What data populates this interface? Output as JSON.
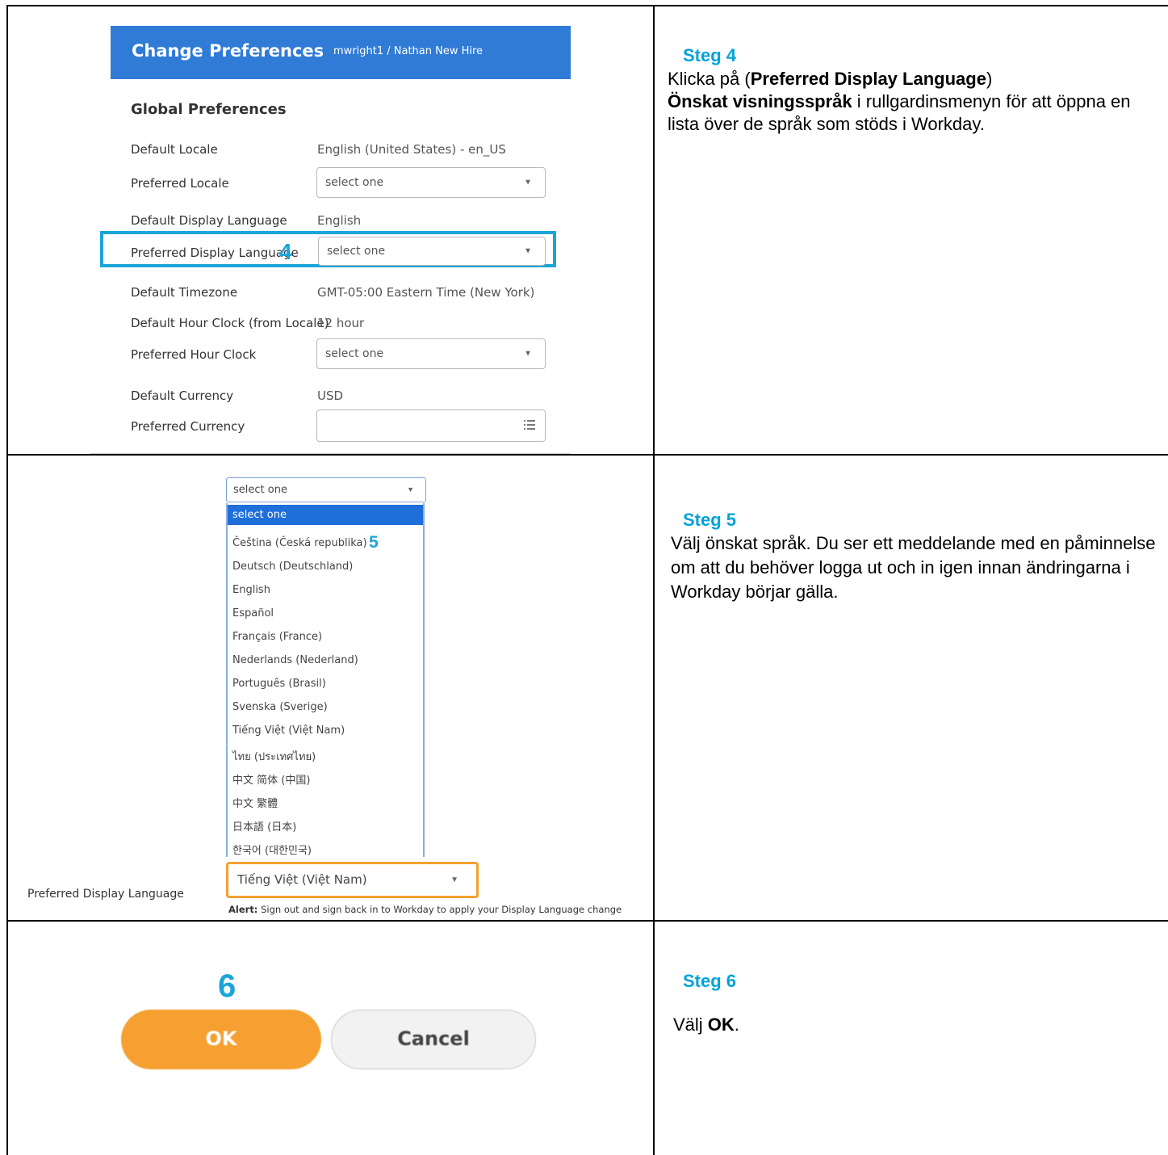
{
  "step4": {
    "header_title": "Change Preferences",
    "header_user": "mwright1 / Nathan New Hire",
    "section_title": "Global Preferences",
    "rows": [
      {
        "label": "Default Locale",
        "value": "English (United States) - en_US"
      },
      {
        "label": "Preferred Locale",
        "value": "select one"
      },
      {
        "label": "Default Display Language",
        "value": "English"
      },
      {
        "label": "Preferred Display Language",
        "value": "select one"
      },
      {
        "label": "Default Timezone",
        "value": "GMT-05:00 Eastern Time (New York)"
      },
      {
        "label": "Default Hour Clock (from Locale)",
        "value": "12 hour"
      },
      {
        "label": "Preferred Hour Clock",
        "value": "select one"
      },
      {
        "label": "Default Currency",
        "value": "USD"
      },
      {
        "label": "Preferred Currency",
        "value": ""
      }
    ],
    "marker": "4",
    "steg_title": "Steg 4",
    "desc_1": "Klicka på (",
    "desc_bold_1": "Preferred Display Language",
    "desc_2": ") ",
    "desc_bold_2": "Önskat visningsspråk",
    "desc_3": " i rullgardinsmenyn för att öppna en lista över de språk som stöds i Workday."
  },
  "step5": {
    "dropdown_value": "select one",
    "options": [
      "select one",
      "Čeština (Česká republika)",
      "Deutsch (Deutschland)",
      "English",
      "Español",
      "Français (France)",
      "Nederlands (Nederland)",
      "Português (Brasil)",
      "Svenska (Sverige)",
      "Tiếng Việt (Việt Nam)",
      "ไทย (ประเทศไทย)",
      "中文 简体 (中国)",
      "中文 繁體",
      "日本語 (日本)",
      "한국어 (대한민국)"
    ],
    "marker": "5",
    "field_label": "Preferred Display Language",
    "field_value": "Tiếng Việt (Việt Nam)",
    "alert_label": "Alert:",
    "alert_text": " Sign out and sign back in to Workday to apply your Display Language change",
    "steg_title": "Steg 5",
    "desc": "Välj önskat språk. Du ser ett meddelande med en påminnelse om att du behöver logga ut och in igen innan ändringarna i Workday börjar gälla."
  },
  "step6": {
    "marker": "6",
    "ok_label": "OK",
    "cancel_label": "Cancel",
    "steg_title": "Steg 6",
    "desc_1": "Välj ",
    "desc_bold": "OK",
    "desc_2": "."
  },
  "colors": {
    "header_blue": "#2f7bd6",
    "highlight_blue": "#1ba5d8",
    "steg_blue": "#00a3d9",
    "ok_orange": "#f5a030",
    "selected_option_blue": "#1e6fd9"
  },
  "icons": [
    "chevron-down-icon",
    "list-icon"
  ]
}
